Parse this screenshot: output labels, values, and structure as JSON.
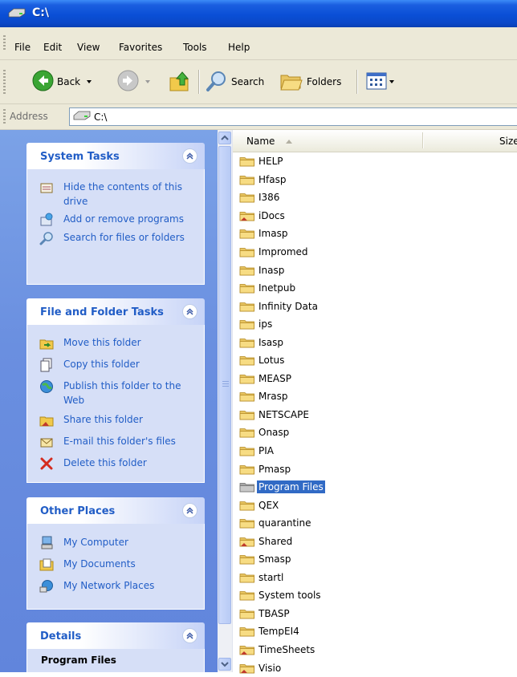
{
  "window": {
    "title": "C:\\",
    "title_icon": "drive-icon"
  },
  "menubar": {
    "items": [
      "File",
      "Edit",
      "View",
      "Favorites",
      "Tools",
      "Help"
    ]
  },
  "toolbar": {
    "back_label": "Back",
    "search_label": "Search",
    "folders_label": "Folders"
  },
  "address": {
    "label": "Address",
    "value": "C:\\"
  },
  "tasks": {
    "system": {
      "title": "System Tasks",
      "items": [
        "Hide the contents of this drive",
        "Add or remove programs",
        "Search for files or folders"
      ]
    },
    "file_folder": {
      "title": "File and Folder Tasks",
      "items": [
        "Move this folder",
        "Copy this folder",
        "Publish this folder to the Web",
        "Share this folder",
        "E-mail this folder's files",
        "Delete this folder"
      ]
    },
    "other": {
      "title": "Other Places",
      "items": [
        "My Computer",
        "My Documents",
        "My Network Places"
      ]
    },
    "details": {
      "title": "Details",
      "item_name": "Program Files"
    }
  },
  "filelist": {
    "columns": {
      "name": "Name",
      "size": "Size"
    },
    "items": [
      "HELP",
      "Hfasp",
      "I386",
      "iDocs",
      "Imasp",
      "Impromed",
      "Inasp",
      "Inetpub",
      "Infinity Data",
      "ips",
      "Isasp",
      "Lotus",
      "MEASP",
      "Mrasp",
      "NETSCAPE",
      "Onasp",
      "PIA",
      "Pmasp",
      "Program Files",
      "QEX",
      "quarantine",
      "Shared",
      "Smasp",
      "startl",
      "System tools",
      "TBASP",
      "TempEI4",
      "TimeSheets",
      "Visio"
    ],
    "selected": "Program Files"
  },
  "colors": {
    "titlebar": "#0a4fd6",
    "link": "#215dc6",
    "selection": "#316ac5",
    "taskpane": "#6a8fe0"
  }
}
